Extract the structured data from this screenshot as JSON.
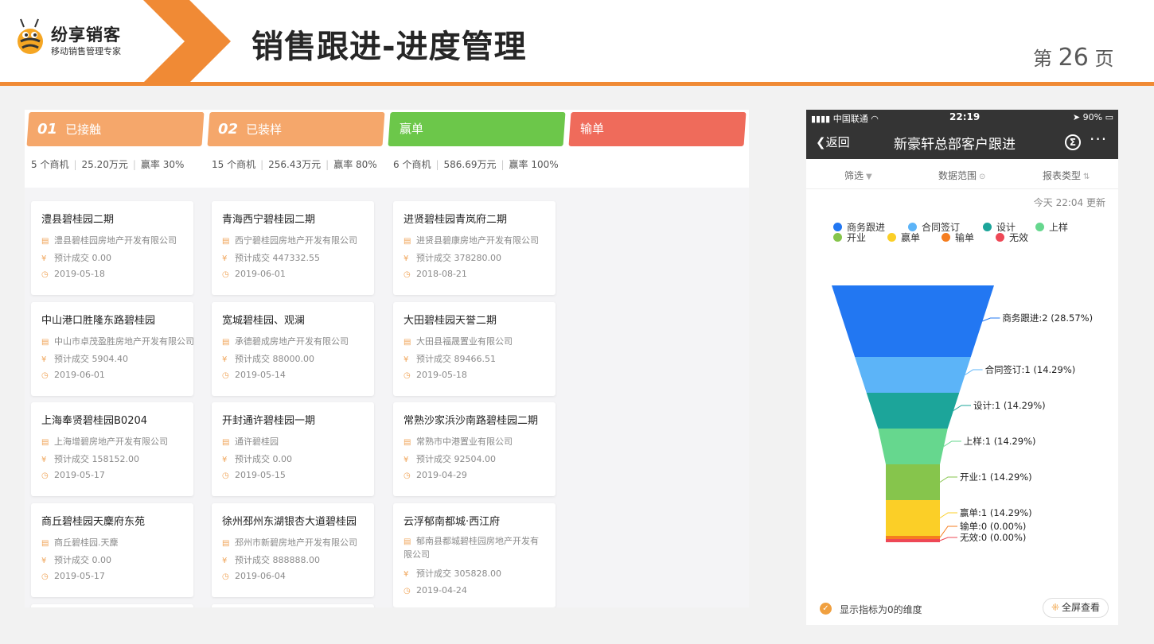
{
  "header": {
    "logo_name": "纷享销客",
    "logo_sub": "移动销售管理专家",
    "title": "销售跟进-进度管理",
    "page_prefix": "第",
    "page_number": "26",
    "page_suffix": "页"
  },
  "colors": {
    "accent": "#f08a35",
    "stage1": "#f5a76b",
    "stage2": "#f5a76b",
    "won": "#6cc74a",
    "lost": "#ef6b5b"
  },
  "stages": [
    {
      "num": "01",
      "label": "已接触",
      "deals": "5 个商机",
      "amount": "25.20万元",
      "rate": "赢率 30%"
    },
    {
      "num": "02",
      "label": "已装样",
      "deals": "15 个商机",
      "amount": "256.43万元",
      "rate": "赢率 80%"
    },
    {
      "num": "",
      "label": "赢单",
      "deals": "6 个商机",
      "amount": "586.69万元",
      "rate": "赢率 100%"
    },
    {
      "num": "",
      "label": "输单",
      "deals": "",
      "amount": "",
      "rate": ""
    }
  ],
  "cards": [
    [
      {
        "title": "澧县碧桂园二期",
        "company": "澧县碧桂园房地产开发有限公司",
        "amount": "预计成交 0.00",
        "date": "2019-05-18"
      },
      {
        "title": "中山港口胜隆东路碧桂园",
        "company": "中山市卓茂盈胜房地产开发有限公司",
        "amount": "预计成交 5904.40",
        "date": "2019-06-01"
      },
      {
        "title": "上海奉贤碧桂园B0204",
        "company": "上海增碧房地产开发有限公司",
        "amount": "预计成交 158152.00",
        "date": "2019-05-17"
      },
      {
        "title": "商丘碧桂园天麇府东苑",
        "company": "商丘碧桂园.天麇",
        "amount": "预计成交 0.00",
        "date": "2019-05-17"
      }
    ],
    [
      {
        "title": "青海西宁碧桂园二期",
        "company": "西宁碧桂园房地产开发有限公司",
        "amount": "预计成交 447332.55",
        "date": "2019-06-01"
      },
      {
        "title": "宽城碧桂园、观澜",
        "company": "承德碧成房地产开发有限公司",
        "amount": "预计成交 88000.00",
        "date": "2019-05-14"
      },
      {
        "title": "开封通许碧桂园一期",
        "company": "通许碧桂园",
        "amount": "预计成交 0.00",
        "date": "2019-05-15"
      },
      {
        "title": "徐州邳州东湖银杏大道碧桂园",
        "company": "邳州市新碧房地产开发有限公司",
        "amount": "预计成交 888888.00",
        "date": "2019-06-04"
      }
    ],
    [
      {
        "title": "进贤碧桂园青岚府二期",
        "company": "进贤县碧康房地产开发有限公司",
        "amount": "预计成交 378280.00",
        "date": "2018-08-21"
      },
      {
        "title": "大田碧桂园天誉二期",
        "company": "大田县福晟置业有限公司",
        "amount": "预计成交 89466.51",
        "date": "2019-05-18"
      },
      {
        "title": "常熟沙家浜沙南路碧桂园二期",
        "company": "常熟市中港置业有限公司",
        "amount": "预计成交 92504.00",
        "date": "2019-04-29"
      },
      {
        "title": "云浮郁南都城·西江府",
        "company": "郁南县都城碧桂园房地产开发有限公司",
        "amount": "预计成交 305828.00",
        "date": "2019-04-24"
      }
    ]
  ],
  "phone": {
    "carrier": "中国联通",
    "time": "22:19",
    "battery": "90%",
    "back": "返回",
    "title": "新豪轩总部客户跟进",
    "filter": "筛选",
    "range": "数据范围",
    "report_type": "报表类型",
    "updated": "今天 22:04 更新",
    "show_zero": "显示指标为0的维度",
    "fullscreen": "全屏查看"
  },
  "chart_data": {
    "type": "funnel",
    "series": [
      {
        "name": "商务跟进",
        "value": 2,
        "percent": "28.57%",
        "color": "#2277f2",
        "label": "商务跟进:2 (28.57%)"
      },
      {
        "name": "合同签订",
        "value": 1,
        "percent": "14.29%",
        "color": "#5cb4f8",
        "label": "合同签订:1 (14.29%)"
      },
      {
        "name": "设计",
        "value": 1,
        "percent": "14.29%",
        "color": "#1ca59a",
        "label": "设计:1 (14.29%)"
      },
      {
        "name": "上样",
        "value": 1,
        "percent": "14.29%",
        "color": "#66d78e",
        "label": "上样:1 (14.29%)"
      },
      {
        "name": "开业",
        "value": 1,
        "percent": "14.29%",
        "color": "#86c54c",
        "label": "开业:1 (14.29%)"
      },
      {
        "name": "赢单",
        "value": 1,
        "percent": "14.29%",
        "color": "#fbcf27",
        "label": "赢单:1 (14.29%)"
      },
      {
        "name": "输单",
        "value": 0,
        "percent": "0.00%",
        "color": "#f57d1f",
        "label": "输单:0 (0.00%)"
      },
      {
        "name": "无效",
        "value": 0,
        "percent": "0.00%",
        "color": "#ee4856",
        "label": "无效:0 (0.00%)"
      }
    ]
  }
}
